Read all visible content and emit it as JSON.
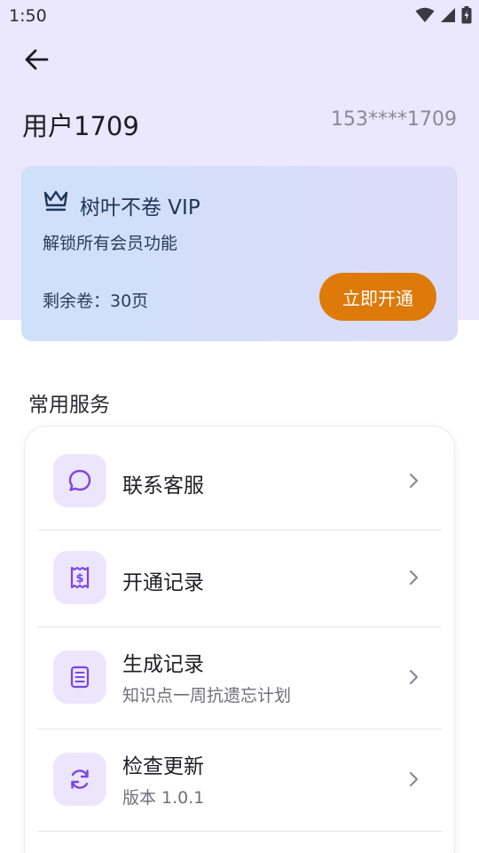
{
  "status_bar": {
    "time": "1:50",
    "icons": [
      "wifi-icon",
      "signal-icon",
      "battery-charging-icon"
    ]
  },
  "header": {
    "back_icon": "arrow-left-icon",
    "user_name": "用户1709",
    "phone": "153****1709"
  },
  "vip_card": {
    "icon": "crown-icon",
    "title": "树叶不卷 VIP",
    "subtitle": "解锁所有会员功能",
    "remaining_pages": "剩余卷：30页",
    "button_label": "立即开通",
    "accent_color": "#dd7a0a"
  },
  "services": {
    "title": "常用服务",
    "items": [
      {
        "label": "联系客服",
        "sub": "",
        "icon": "chat-bubble-icon"
      },
      {
        "label": "开通记录",
        "sub": "",
        "icon": "receipt-dollar-icon"
      },
      {
        "label": "生成记录",
        "sub": "知识点一周抗遗忘计划",
        "icon": "notebook-icon"
      },
      {
        "label": "检查更新",
        "sub": "版本 1.0.1",
        "icon": "refresh-icon"
      }
    ]
  },
  "colors": {
    "header_bg": "#ebe7fd",
    "icon_bg": "#ece6fd",
    "icon_color": "#7b45e6"
  }
}
